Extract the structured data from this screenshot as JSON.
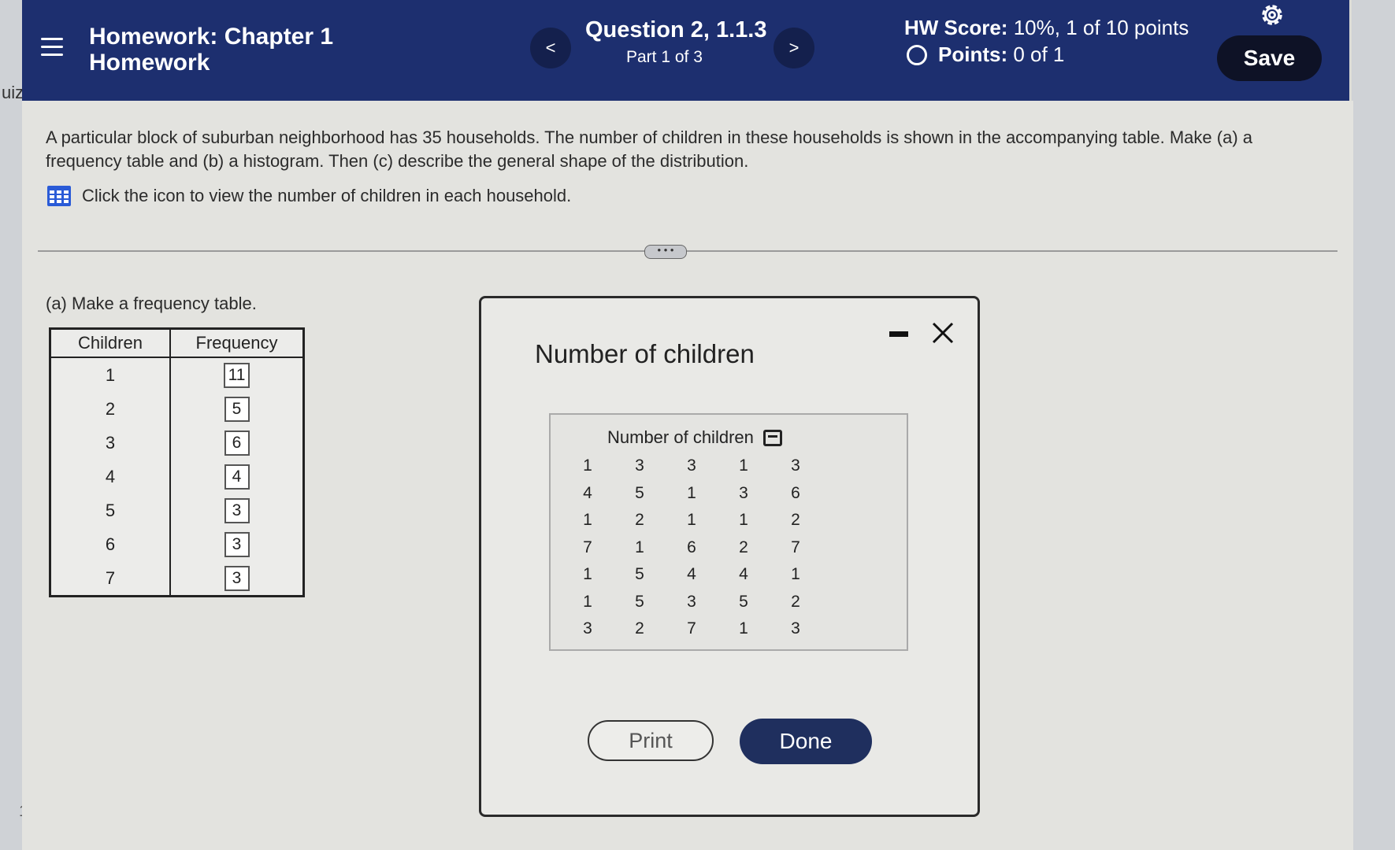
{
  "sidebar": {
    "partial_label": "uiz",
    "page_number": "1"
  },
  "header": {
    "title_line1": "Homework:  Chapter 1",
    "title_line2": "Homework",
    "prev_label": "<",
    "next_label": ">",
    "question_title": "Question 2, 1.1.3",
    "question_part": "Part 1 of 3",
    "hw_score_label": "HW Score:",
    "hw_score_value": "10%, 1 of 10 points",
    "points_label": "Points:",
    "points_value": "0 of 1",
    "save_label": "Save"
  },
  "question": {
    "text": "A particular block of suburban neighborhood has 35 households. The number of children in these households is shown in the accompanying table. Make (a) a frequency table and (b) a histogram. Then (c) describe the general shape of the distribution.",
    "data_link": "Click the icon to view the number of children in each household.",
    "expand_label": "• • •"
  },
  "part_a": {
    "label": "(a) Make a frequency table.",
    "headers": [
      "Children",
      "Frequency"
    ],
    "rows": [
      {
        "children": "1",
        "frequency": "11"
      },
      {
        "children": "2",
        "frequency": "5"
      },
      {
        "children": "3",
        "frequency": "6"
      },
      {
        "children": "4",
        "frequency": "4"
      },
      {
        "children": "5",
        "frequency": "3"
      },
      {
        "children": "6",
        "frequency": "3"
      },
      {
        "children": "7",
        "frequency": "3"
      }
    ]
  },
  "modal": {
    "title": "Number of children",
    "data_caption": "Number of children",
    "data": [
      [
        "1",
        "3",
        "3",
        "1",
        "3"
      ],
      [
        "4",
        "5",
        "1",
        "3",
        "6"
      ],
      [
        "1",
        "2",
        "1",
        "1",
        "2"
      ],
      [
        "7",
        "1",
        "6",
        "2",
        "7"
      ],
      [
        "1",
        "5",
        "4",
        "4",
        "1"
      ],
      [
        "1",
        "5",
        "3",
        "5",
        "2"
      ],
      [
        "3",
        "2",
        "7",
        "1",
        "3"
      ]
    ],
    "print_label": "Print",
    "done_label": "Done"
  },
  "colors": {
    "header_bg": "#1d2f6f",
    "save_bg": "#0e1226",
    "done_bg": "#1f2f5e"
  }
}
